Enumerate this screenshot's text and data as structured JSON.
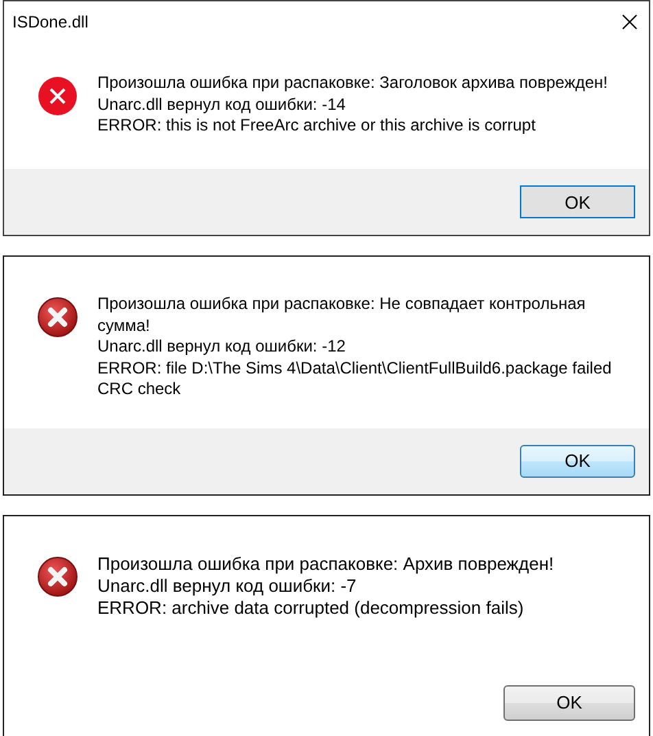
{
  "dialogs": [
    {
      "title": "ISDone.dll",
      "kind": "flat",
      "footer_shaded": true,
      "lines": [
        "Произошла ошибка при распаковке: Заголовок архива поврежден!",
        "Unarc.dll вернул код ошибки: -14",
        "ERROR: this is not FreeArc archive or this archive is corrupt"
      ],
      "button": "OK"
    },
    {
      "kind": "glossy",
      "footer_shaded": true,
      "lines": [
        "Произошла ошибка при распаковке: Не совпадает контрольная сумма!",
        "Unarc.dll вернул код ошибки: -12",
        "ERROR: file D:\\The Sims 4\\Data\\Client\\ClientFullBuild6.package failed CRC check"
      ],
      "button": "OK"
    },
    {
      "kind": "glossy",
      "footer_shaded": false,
      "lines": [
        "Произошла ошибка при распаковке: Архив поврежден!",
        "Unarc.dll вернул код ошибки: -7",
        "ERROR: archive data corrupted (decompression fails)"
      ],
      "button": "OK"
    }
  ]
}
